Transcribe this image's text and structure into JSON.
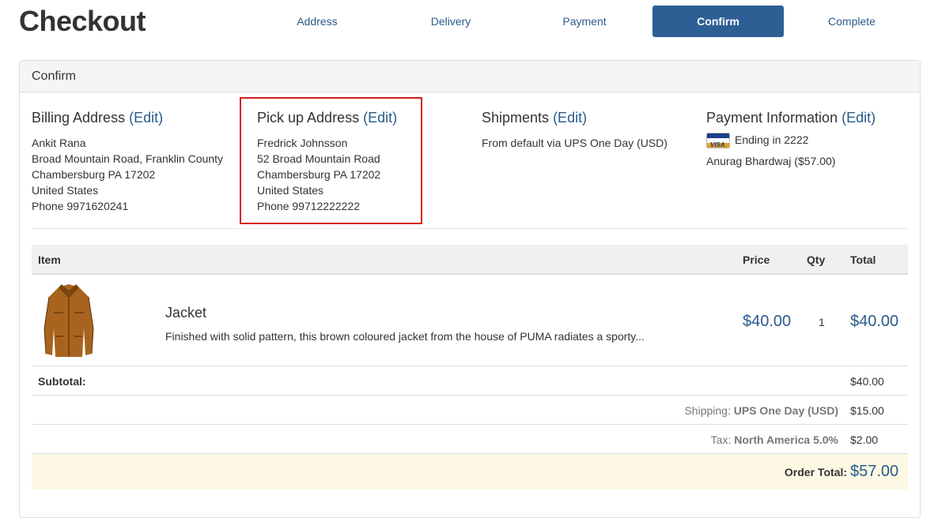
{
  "page": {
    "title": "Checkout"
  },
  "steps": [
    "Address",
    "Delivery",
    "Payment",
    "Confirm",
    "Complete"
  ],
  "active_step": "Confirm",
  "panel": {
    "title": "Confirm"
  },
  "edit_label": "(Edit)",
  "billing": {
    "heading": "Billing Address",
    "name": "Ankit Rana",
    "address1": "Broad Mountain Road, Franklin County",
    "city_line": "Chambersburg PA 17202",
    "country": "United States",
    "phone": "Phone 9971620241"
  },
  "pickup": {
    "heading": "Pick up Address",
    "name": "Fredrick Johnsson",
    "address1": "52 Broad Mountain Road",
    "city_line": "Chambersburg PA 17202",
    "country": "United States",
    "phone": "Phone 99712222222"
  },
  "shipments": {
    "heading": "Shipments",
    "text": "From default via UPS One Day (USD)"
  },
  "payment": {
    "heading": "Payment Information",
    "card_brand": "VISA",
    "card_text": "Ending in 2222",
    "payer": "Anurag Bhardwaj ($57.00)"
  },
  "table": {
    "headers": {
      "item": "Item",
      "price": "Price",
      "qty": "Qty",
      "total": "Total"
    },
    "item": {
      "name": "Jacket",
      "description": "Finished with solid pattern, this brown coloured jacket from the house of PUMA radiates a sporty...",
      "price": "$40.00",
      "qty": "1",
      "total": "$40.00"
    }
  },
  "summary": {
    "subtotal_label": "Subtotal:",
    "subtotal": "$40.00",
    "shipping_prefix": "Shipping:",
    "shipping_method": "UPS One Day (USD)",
    "shipping": "$15.00",
    "tax_prefix": "Tax:",
    "tax_method": "North America 5.0%",
    "tax": "$2.00",
    "order_total_label": "Order Total:",
    "order_total": "$57.00"
  },
  "colors": {
    "accent": "#2d5f95",
    "link": "#2a5a8c",
    "highlight_border": "#d62020",
    "total_bg": "#fcf8e3"
  }
}
